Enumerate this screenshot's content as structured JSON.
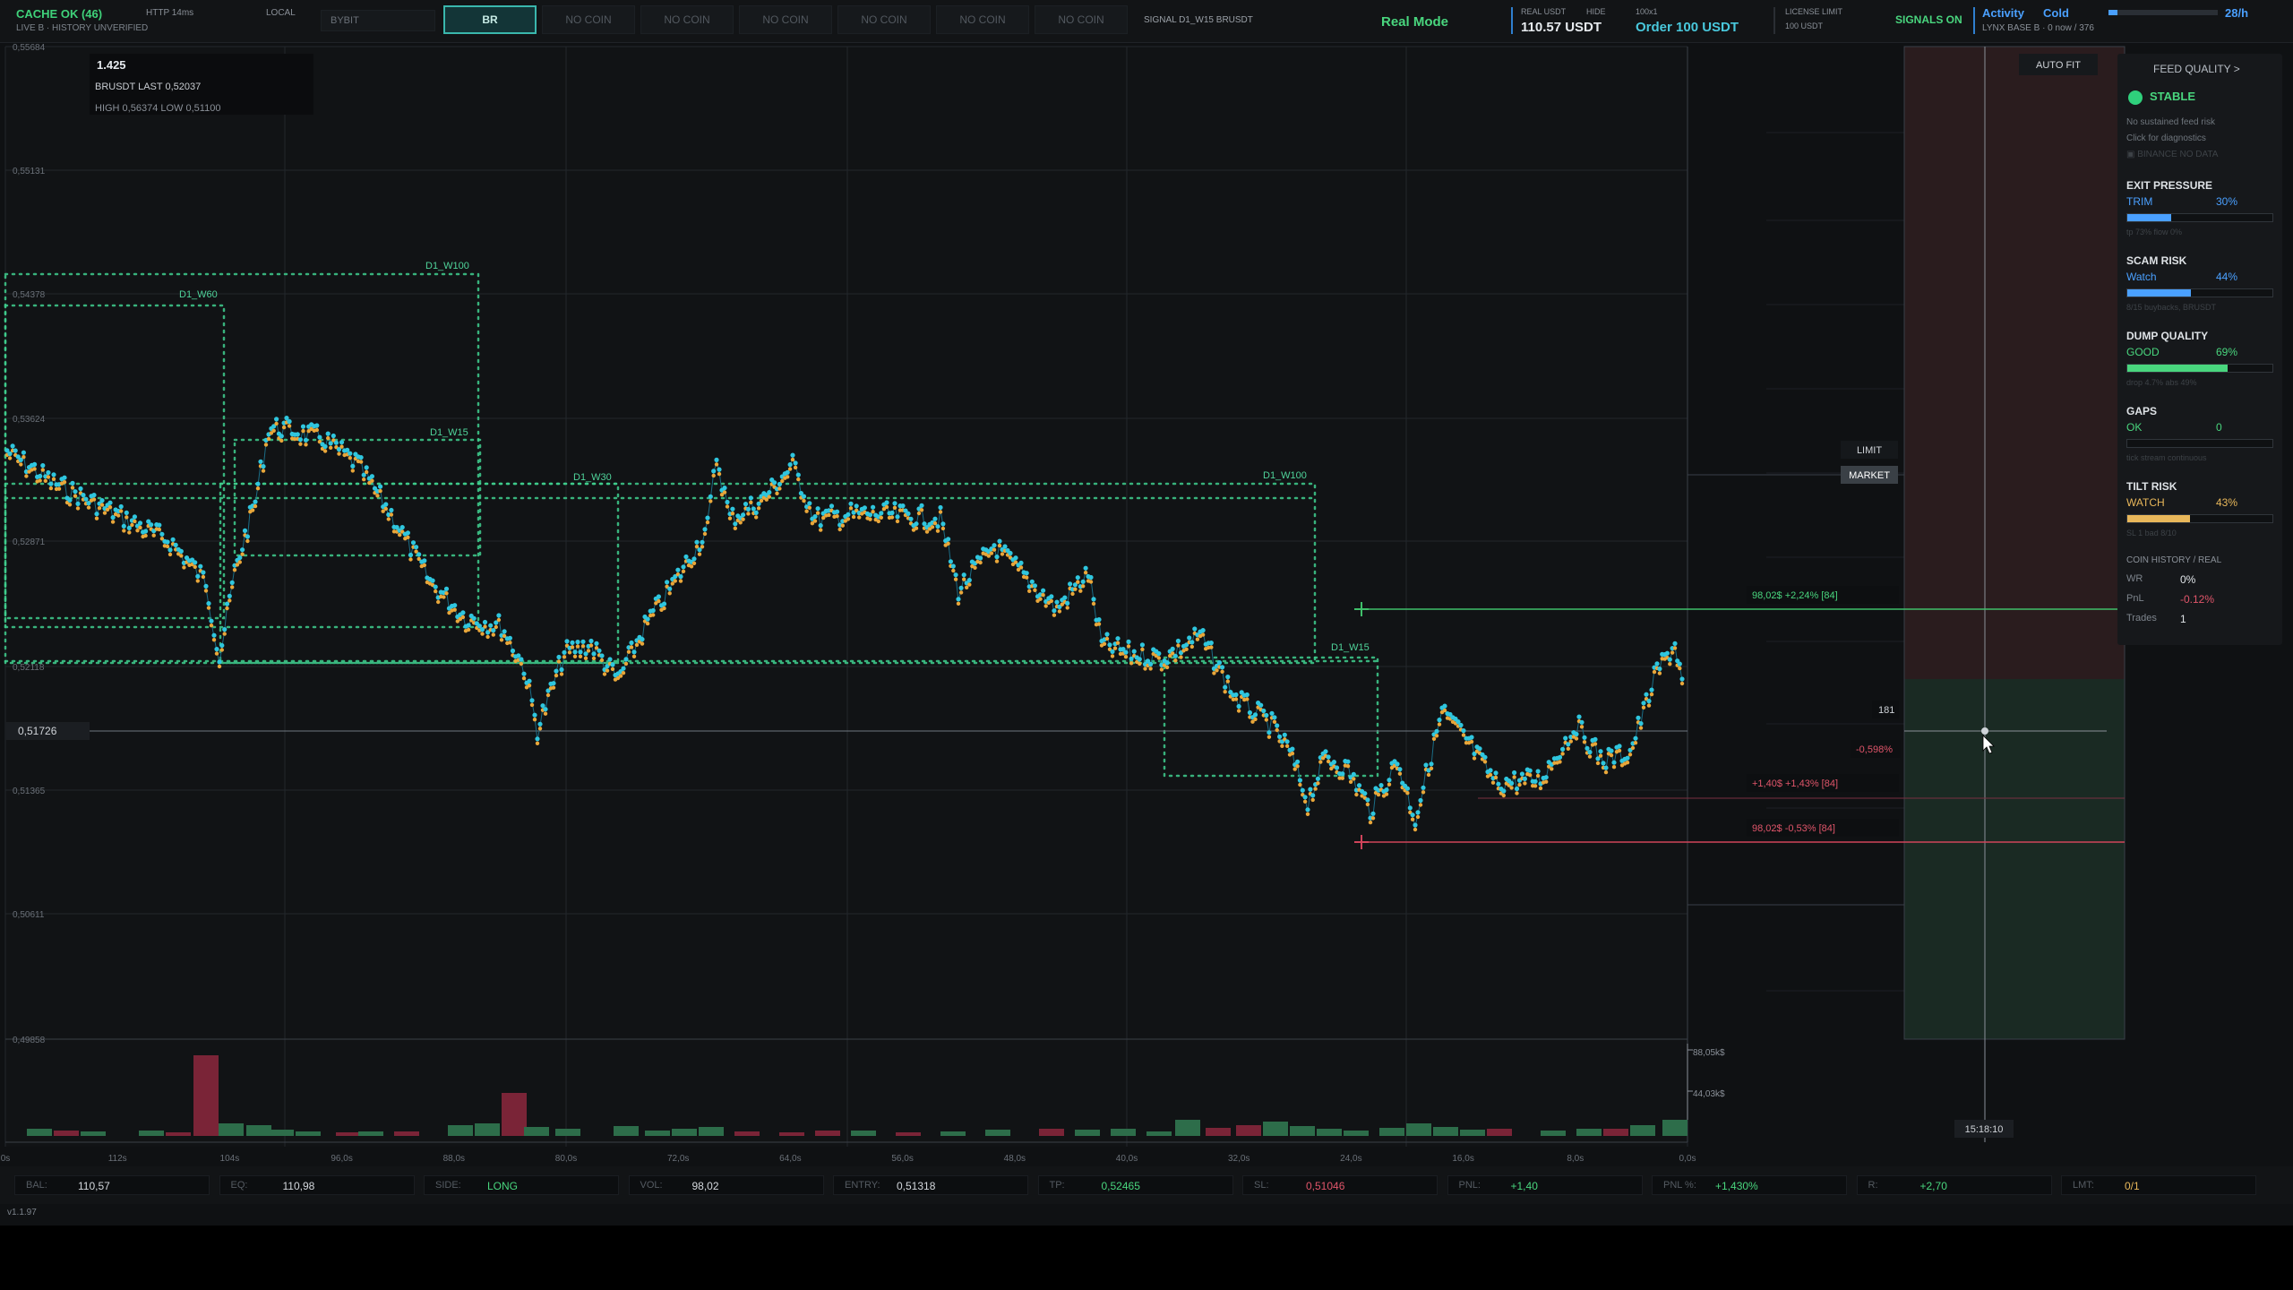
{
  "topbar": {
    "cache_status": "CACHE OK (46)",
    "sub_status": "LIVE B · HISTORY UNVERIFIED",
    "http": "HTTP 14ms",
    "local": "LOCAL",
    "exchange": "BYBIT",
    "coin_buttons": [
      "BR",
      "NO COIN",
      "NO COIN",
      "NO COIN",
      "NO COIN",
      "NO COIN",
      "NO COIN"
    ],
    "signal": "SIGNAL D1_W15 BRUSDT",
    "mode": "Real Mode",
    "real_label": "REAL USDT",
    "hide": "HIDE",
    "real_value": "110.57 USDT",
    "leverage": "100x1",
    "order": "Order 100 USDT",
    "license_label": "LICENSE LIMIT",
    "license_value": "100 USDT",
    "signals": "SIGNALS ON",
    "activity": "Activity",
    "cold": "Cold",
    "lynx": "LYNX BASE B · 0 now / 376",
    "activity_level": 0.08,
    "rate": "28/h"
  },
  "chart": {
    "scale": "1.425",
    "symbol_line": "BRUSDT  LAST 0,52037",
    "hl_line": "HIGH 0,56374   LOW 0,51100",
    "y_ticks": [
      "0,55684",
      "0,55131",
      "0,54378",
      "0,53624",
      "0,52871",
      "0,52118",
      "0,51365",
      "0,50611",
      "0,49858"
    ],
    "current_price": "0,51726",
    "x_ticks": [
      "0s",
      "112s",
      "104s",
      "96,0s",
      "88,0s",
      "80,0s",
      "72,0s",
      "64,0s",
      "56,0s",
      "48,0s",
      "40,0s",
      "32,0s",
      "24,0s",
      "16,0s",
      "8,0s",
      "0,0s"
    ],
    "vol_ticks": [
      "88,05k$",
      "44,03k$"
    ],
    "auto_fit": "AUTO FIT",
    "limit": "LIMIT",
    "market": "MARKET",
    "tp_label": "98,02$  +2,24% [84]",
    "pnl_label": "+1,40$  +1,43% [84]",
    "sl_label": "98,02$  -0,53% [84]",
    "dist_label": "-0,598%",
    "qty_label": "181",
    "time_label": "15:18:10",
    "zones": [
      "D1_W100",
      "D1_W60",
      "D1_W15",
      "D1_W30",
      "D1_W100",
      "D1_W15"
    ]
  },
  "panel": {
    "title": "FEED QUALITY  >",
    "status": "STABLE",
    "risk_note": "No sustained feed risk",
    "diag": "Click for diagnostics",
    "binance": "BINANCE NO DATA",
    "metrics": [
      {
        "title": "EXIT PRESSURE",
        "status": "TRIM",
        "pct": "30%",
        "value": 0.3,
        "color": "#4aa0ff",
        "hint": "tp 73%  flow 0%"
      },
      {
        "title": "SCAM RISK",
        "status": "Watch",
        "pct": "44%",
        "value": 0.44,
        "color": "#4aa0ff",
        "hint": "8/15 buybacks, BRUSDT"
      },
      {
        "title": "DUMP QUALITY",
        "status": "GOOD",
        "pct": "69%",
        "value": 0.69,
        "color": "#49d67e",
        "hint": "drop 4.7%  abs 49%"
      },
      {
        "title": "GAPS",
        "status": "OK",
        "pct": "0",
        "value": 0.0,
        "color": "#49d67e",
        "hint": "tick stream continuous"
      },
      {
        "title": "TILT RISK",
        "status": "WATCH",
        "pct": "43%",
        "value": 0.43,
        "color": "#e8b75a",
        "hint": "SL 1  bad 8/10"
      }
    ],
    "history_title": "COIN HISTORY / REAL",
    "wr_label": "WR",
    "wr": "0%",
    "pnl_label": "PnL",
    "pnl": "-0.12%",
    "trades_label": "Trades",
    "trades": "1"
  },
  "stats": [
    {
      "k": "BAL:",
      "v": "110,57",
      "color": "#d3d7dc"
    },
    {
      "k": "EQ:",
      "v": "110,98",
      "color": "#d3d7dc"
    },
    {
      "k": "SIDE:",
      "v": "LONG",
      "color": "#49d67e"
    },
    {
      "k": "VOL:",
      "v": "98,02",
      "color": "#d3d7dc"
    },
    {
      "k": "ENTRY:",
      "v": "0,51318",
      "color": "#d3d7dc"
    },
    {
      "k": "TP:",
      "v": "0,52465",
      "color": "#49d67e"
    },
    {
      "k": "SL:",
      "v": "0,51046",
      "color": "#e0556a"
    },
    {
      "k": "PNL:",
      "v": "+1,40",
      "color": "#49d67e"
    },
    {
      "k": "PNL %:",
      "v": "+1,430%",
      "color": "#49d67e"
    },
    {
      "k": "R:",
      "v": "+2,70",
      "color": "#49d67e"
    },
    {
      "k": "LMT:",
      "v": "0/1",
      "color": "#e8b75a"
    }
  ],
  "version": "v1.1.97"
}
